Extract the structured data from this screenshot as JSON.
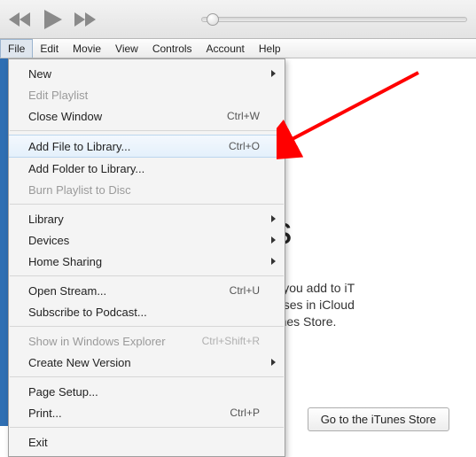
{
  "menubar": {
    "items": [
      "File",
      "Edit",
      "Movie",
      "View",
      "Controls",
      "Account",
      "Help"
    ],
    "active_index": 0
  },
  "file_menu": {
    "groups": [
      [
        {
          "label": "New",
          "submenu": true
        },
        {
          "label": "Edit Playlist",
          "disabled": true
        },
        {
          "label": "Close Window",
          "shortcut": "Ctrl+W"
        }
      ],
      [
        {
          "label": "Add File to Library...",
          "shortcut": "Ctrl+O",
          "highlight": true
        },
        {
          "label": "Add Folder to Library..."
        },
        {
          "label": "Burn Playlist to Disc",
          "disabled": true
        }
      ],
      [
        {
          "label": "Library",
          "submenu": true
        },
        {
          "label": "Devices",
          "submenu": true
        },
        {
          "label": "Home Sharing",
          "submenu": true
        }
      ],
      [
        {
          "label": "Open Stream...",
          "shortcut": "Ctrl+U"
        },
        {
          "label": "Subscribe to Podcast..."
        }
      ],
      [
        {
          "label": "Show in Windows Explorer",
          "shortcut": "Ctrl+Shift+R",
          "disabled": true
        },
        {
          "label": "Create New Version",
          "submenu": true
        }
      ],
      [
        {
          "label": "Page Setup..."
        },
        {
          "label": "Print...",
          "shortcut": "Ctrl+P"
        }
      ],
      [
        {
          "label": "Exit"
        }
      ]
    ]
  },
  "content": {
    "heading": "Movies",
    "body": "es and home videos you add to iT\ny. Your movie purchases in iCloud\ne signed into the iTunes Store.",
    "store_button": "Go to the iTunes Store"
  },
  "icons": {
    "prev": "prev-icon",
    "play": "play-icon",
    "next": "next-icon"
  }
}
